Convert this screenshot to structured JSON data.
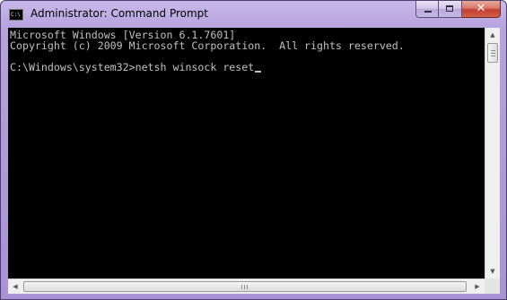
{
  "window": {
    "title": "Administrator: Command Prompt",
    "icon": "cmd-icon",
    "icon_text": "C:\\",
    "caption_buttons": {
      "minimize_icon": "minimize-icon",
      "maximize_icon": "maximize-icon",
      "close_icon": "close-icon",
      "close_glyph": "✕"
    }
  },
  "console": {
    "lines": [
      "Microsoft Windows [Version 6.1.7601]",
      "Copyright (c) 2009 Microsoft Corporation.  All rights reserved.",
      "",
      "C:\\Windows\\system32>netsh winsock reset"
    ],
    "text_color": "#c0c0c0",
    "background_color": "#000000"
  },
  "scrollbars": {
    "up_arrow": "▲",
    "down_arrow": "▼",
    "left_arrow": "◀",
    "right_arrow": "▶"
  }
}
